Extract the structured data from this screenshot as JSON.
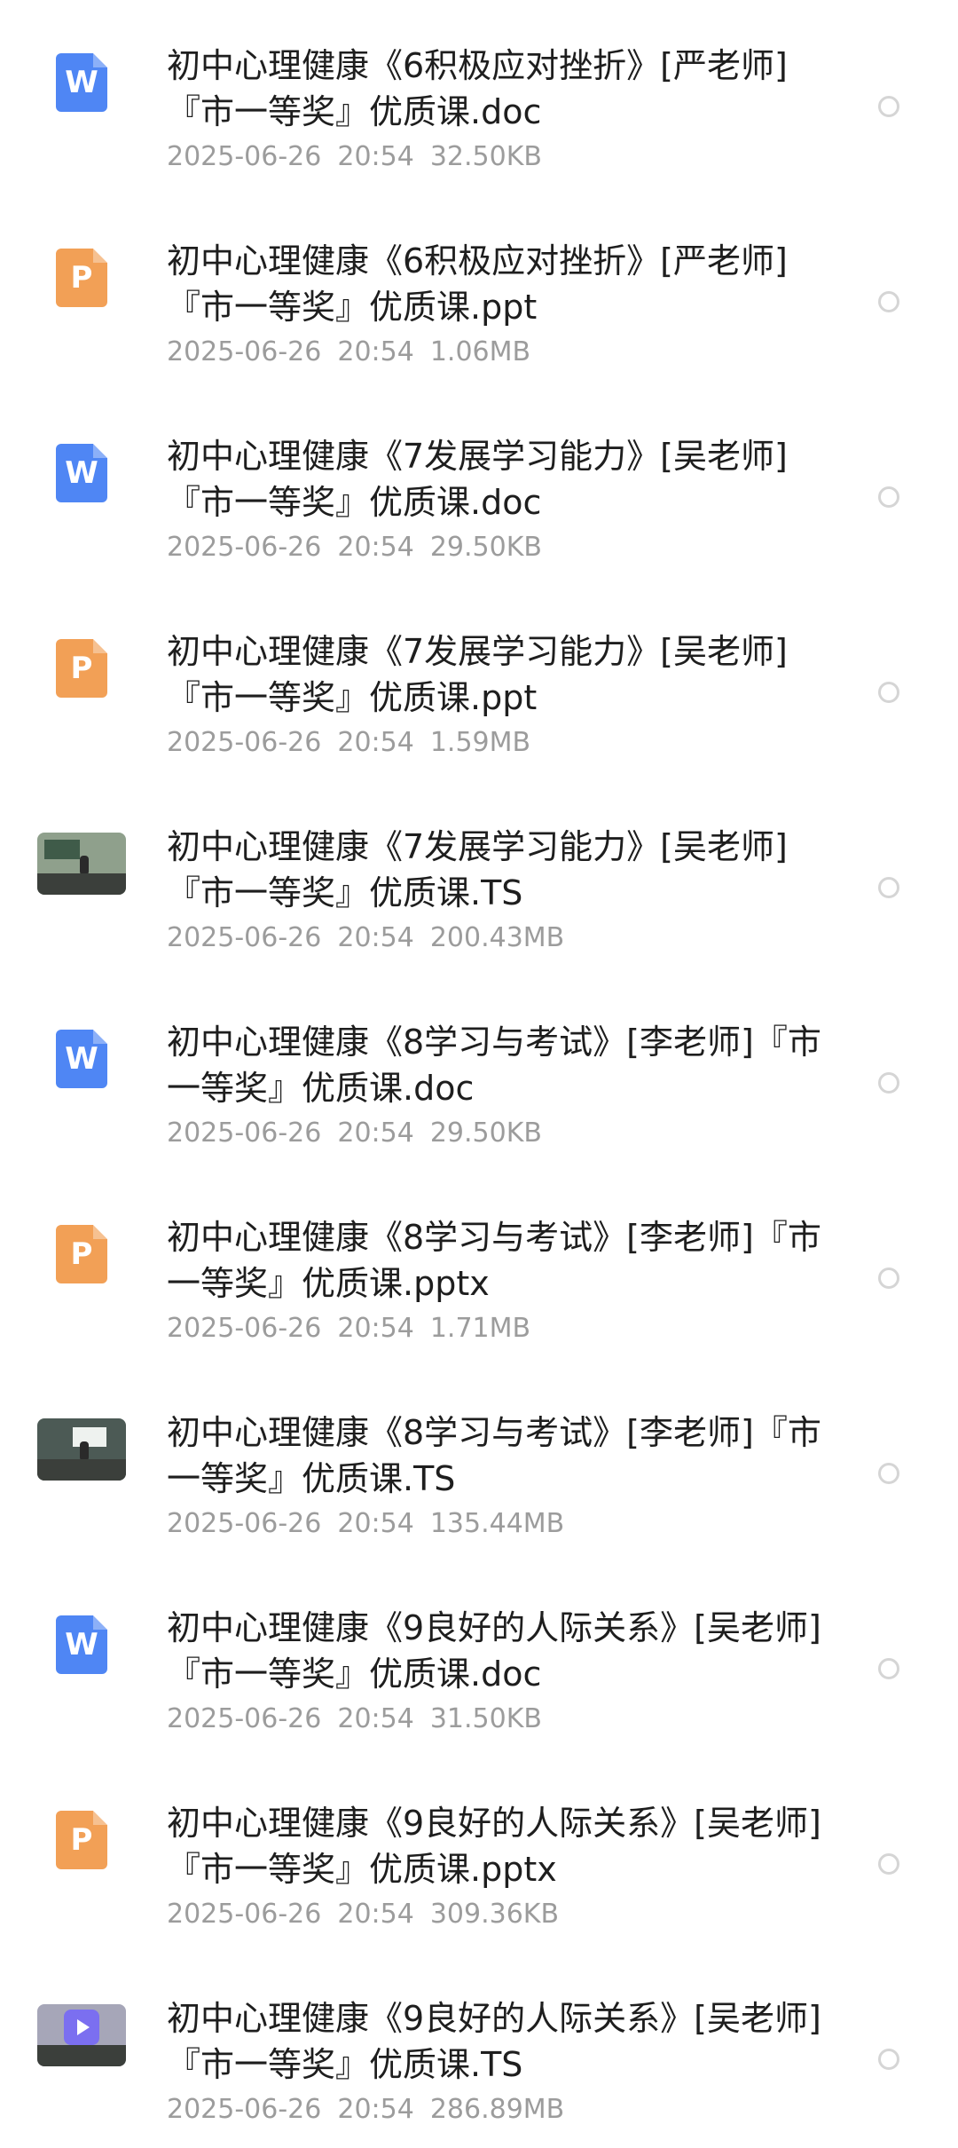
{
  "files": [
    {
      "icon": "word-document-icon",
      "name": "初中心理健康《6积极应对挫折》[严老师]『市一等奖』优质课.doc",
      "date": "2025-06-26",
      "time": "20:54",
      "size": "32.50KB"
    },
    {
      "icon": "powerpoint-document-icon",
      "name": "初中心理健康《6积极应对挫折》[严老师]『市一等奖』优质课.ppt",
      "date": "2025-06-26",
      "time": "20:54",
      "size": "1.06MB"
    },
    {
      "icon": "word-document-icon",
      "name": "初中心理健康《7发展学习能力》[吴老师]『市一等奖』优质课.doc",
      "date": "2025-06-26",
      "time": "20:54",
      "size": "29.50KB"
    },
    {
      "icon": "powerpoint-document-icon",
      "name": "初中心理健康《7发展学习能力》[吴老师]『市一等奖』优质课.ppt",
      "date": "2025-06-26",
      "time": "20:54",
      "size": "1.59MB"
    },
    {
      "icon": "video-thumbnail-icon",
      "name": "初中心理健康《7发展学习能力》[吴老师]『市一等奖』优质课.TS",
      "date": "2025-06-26",
      "time": "20:54",
      "size": "200.43MB"
    },
    {
      "icon": "word-document-icon",
      "name": "初中心理健康《8学习与考试》[李老师]『市一等奖』优质课.doc",
      "date": "2025-06-26",
      "time": "20:54",
      "size": "29.50KB"
    },
    {
      "icon": "powerpoint-document-icon",
      "name": "初中心理健康《8学习与考试》[李老师]『市一等奖』优质课.pptx",
      "date": "2025-06-26",
      "time": "20:54",
      "size": "1.71MB"
    },
    {
      "icon": "video-thumbnail-icon",
      "name": "初中心理健康《8学习与考试》[李老师]『市一等奖』优质课.TS",
      "date": "2025-06-26",
      "time": "20:54",
      "size": "135.44MB"
    },
    {
      "icon": "word-document-icon",
      "name": "初中心理健康《9良好的人际关系》[吴老师]『市一等奖』优质课.doc",
      "date": "2025-06-26",
      "time": "20:54",
      "size": "31.50KB"
    },
    {
      "icon": "powerpoint-document-icon",
      "name": "初中心理健康《9良好的人际关系》[吴老师]『市一等奖』优质课.pptx",
      "date": "2025-06-26",
      "time": "20:54",
      "size": "309.36KB"
    },
    {
      "icon": "video-play-icon",
      "name": "初中心理健康《9良好的人际关系》[吴老师]『市一等奖』优质课.TS",
      "date": "2025-06-26",
      "time": "20:54",
      "size": "286.89MB"
    }
  ],
  "colors": {
    "word": "#4f86f4",
    "ppt": "#f2a056",
    "name_text": "#1e1e1e",
    "meta_text": "#9c9c9c",
    "radio_border": "#d5d5d5"
  }
}
